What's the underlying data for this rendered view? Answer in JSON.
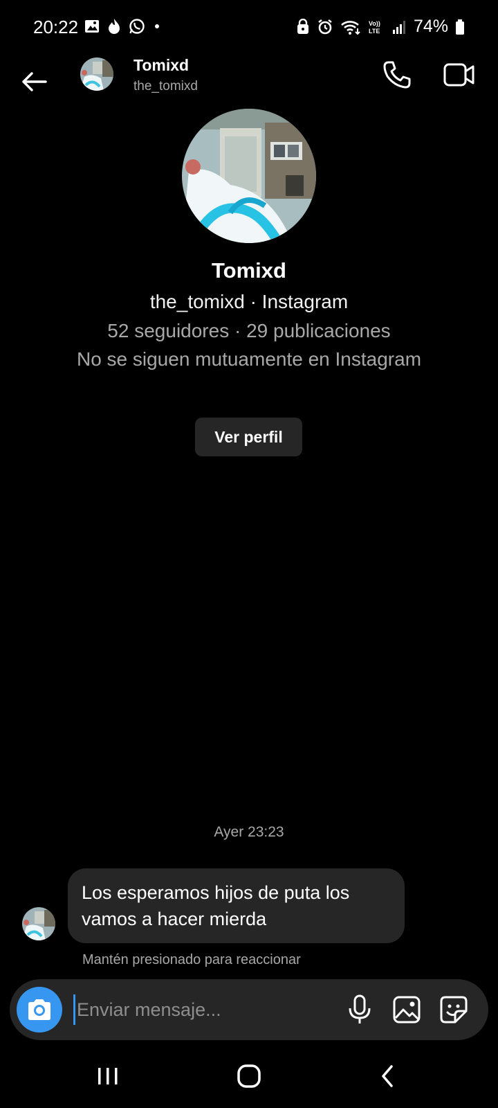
{
  "status_bar": {
    "time": "20:22",
    "battery": "74%",
    "left_icons": [
      "image-icon",
      "fire-icon",
      "whatsapp-icon",
      "dot-icon"
    ],
    "right_icons": [
      "lock-icon",
      "alarm-icon",
      "wifi-icon",
      "volte-icon",
      "signal-icon",
      "battery-icon"
    ]
  },
  "header": {
    "name": "Tomixd",
    "username": "the_tomixd"
  },
  "profile": {
    "name": "Tomixd",
    "subtitle": "the_tomixd · Instagram",
    "stats": "52 seguidores · 29 publicaciones",
    "mutual": "No se siguen mutuamente en Instagram",
    "view_profile_label": "Ver perfil"
  },
  "messages": {
    "timestamp": "Ayer 23:23",
    "items": [
      {
        "text": "Los esperamos hijos de puta los vamos a hacer mierda"
      }
    ],
    "react_hint": "Mantén presionado para reaccionar"
  },
  "composer": {
    "placeholder": "Enviar mensaje..."
  },
  "colors": {
    "background": "#000000",
    "bubble": "#262626",
    "accent": "#3797f0",
    "secondary_text": "#a8a8a8"
  }
}
